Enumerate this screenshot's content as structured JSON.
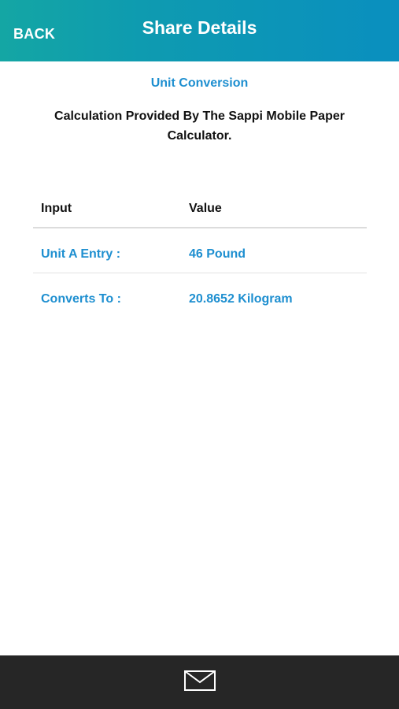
{
  "header": {
    "back_label": "BACK",
    "title": "Share Details"
  },
  "main": {
    "section_title": "Unit Conversion",
    "description": "Calculation Provided By The Sappi Mobile Paper Calculator."
  },
  "table": {
    "columns": [
      "Input",
      "Value"
    ],
    "rows": [
      {
        "label": "Unit A Entry :",
        "value": "46 Pound"
      },
      {
        "label": "Converts To :",
        "value": "20.8652 Kilogram"
      }
    ]
  },
  "footer": {
    "icon": "mail-icon"
  },
  "colors": {
    "header_start": "#14a6a4",
    "header_end": "#0a8fbf",
    "accent": "#1e8fd0",
    "footer": "#262626"
  }
}
